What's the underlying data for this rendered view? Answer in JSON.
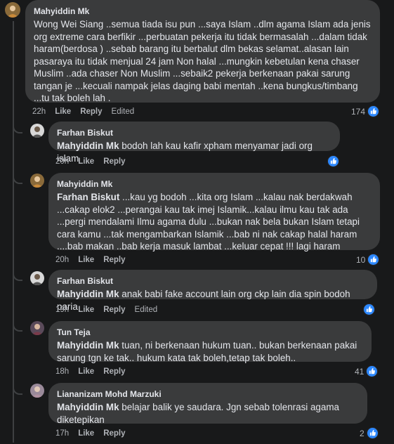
{
  "comments": [
    {
      "author": "Mahyiddin Mk",
      "text": "Wong Wei Siang ..semua tiada isu pun ...saya Islam ..dlm agama Islam ada jenis org extreme cara berfikir ...perbuatan pekerja itu tidak bermasalah ...dalam tidak haram(berdosa ) ..sebab barang itu berbalut dlm bekas selamat..alasan lain pasaraya itu tidak menjual 24 jam Non halal ...mungkin kebetulan kena chaser Muslim ..ada chaser Non Muslim ...sebaik2 pekerja berkenaan pakai sarung tangan je ...kecuali nampak jelas daging babi mentah ..kena bungkus/timbang ...tu tak boleh lah .",
      "time": "22h",
      "like": "Like",
      "reply": "Reply",
      "edited": "Edited",
      "likes": "174"
    },
    {
      "author": "Farhan Biskut",
      "mention": "Mahyiddin Mk",
      "text": " bodoh lah kau kafir xpham menyamar jadi org islam",
      "time": "20h",
      "like": "Like",
      "reply": "Reply",
      "likes": ""
    },
    {
      "author": "Mahyiddin Mk",
      "mention": "Farhan Biskut",
      "text": " ...kau yg bodoh ...kita org Islam ...kalau nak berdakwah ...cakap elok2 ...perangai kau tak imej Islamik...kalau ilmu kau tak ada ...pergi mendalami Ilmu agama dulu ...bukan nak bela bukan Islam tetapi cara kamu ...tak mengambarkan Islamik ...bab ni nak cakap halal haram ....bab makan ..bab kerja masuk lambat ...keluar cepat !!! lagi haram",
      "time": "20h",
      "like": "Like",
      "reply": "Reply",
      "likes": "10"
    },
    {
      "author": "Farhan Biskut",
      "mention": "Mahyiddin Mk",
      "text": " anak babi fake account lain org ckp lain dia spin bodoh paria",
      "time": "19h",
      "like": "Like",
      "reply": "Reply",
      "edited": "Edited",
      "likes": ""
    },
    {
      "author": "Tun Teja",
      "mention": "Mahyiddin Mk",
      "text": " tuan, ni berkenaan hukum tuan.. bukan berkenaan pakai sarung tgn ke tak.. hukum kata tak boleh,tetap tak boleh..",
      "time": "18h",
      "like": "Like",
      "reply": "Reply",
      "likes": "41"
    },
    {
      "author": "Liananizam Mohd Marzuki",
      "mention": "Mahyiddin Mk",
      "text": " belajar balik ye saudara. Jgn sebab tolenrasi agama diketepikan",
      "time": "17h",
      "like": "Like",
      "reply": "Reply",
      "likes": "2"
    }
  ],
  "colors": {
    "bubble": "#3a3b3c",
    "background": "#18191a",
    "like_blue": "#2d88ff"
  }
}
